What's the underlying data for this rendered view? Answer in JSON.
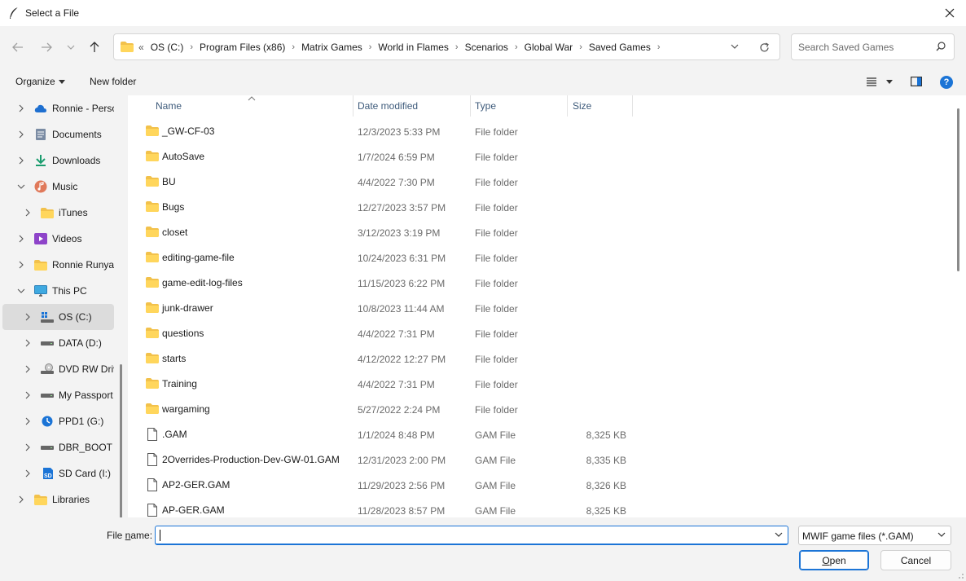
{
  "window": {
    "title": "Select a File",
    "close_label": "✕"
  },
  "nav": {
    "back_label": "←",
    "forward_label": "→",
    "recent_label": "⌄",
    "up_label": "↑",
    "overflow_label": "«",
    "breadcrumbs": [
      "OS (C:)",
      "Program Files (x86)",
      "Matrix Games",
      "World in Flames",
      "Scenarios",
      "Global War",
      "Saved Games"
    ],
    "crumb_sep": "›",
    "search_placeholder": "Search Saved Games"
  },
  "toolbar": {
    "organize_label": "Organize",
    "new_folder_label": "New folder",
    "help_label": "?"
  },
  "sidebar": {
    "items": [
      {
        "label": "Ronnie - Perso",
        "icon": "onedrive-icon",
        "expanded": false,
        "indent": 0
      },
      {
        "label": "Documents",
        "icon": "documents-icon",
        "expanded": false,
        "indent": 0
      },
      {
        "label": "Downloads",
        "icon": "downloads-icon",
        "expanded": false,
        "indent": 0
      },
      {
        "label": "Music",
        "icon": "music-icon",
        "expanded": true,
        "indent": 0
      },
      {
        "label": "iTunes",
        "icon": "folder-icon",
        "expanded": false,
        "indent": 1
      },
      {
        "label": "Videos",
        "icon": "videos-icon",
        "expanded": false,
        "indent": 0
      },
      {
        "label": "Ronnie Runyar",
        "icon": "folder-icon",
        "expanded": false,
        "indent": 0
      },
      {
        "label": "This PC",
        "icon": "monitor-icon",
        "expanded": true,
        "indent": 0
      },
      {
        "label": "OS (C:)",
        "icon": "windows-drive-icon",
        "expanded": false,
        "indent": 1,
        "selected": true
      },
      {
        "label": "DATA (D:)",
        "icon": "drive-icon",
        "expanded": false,
        "indent": 1
      },
      {
        "label": "DVD RW Driv",
        "icon": "dvd-drive-icon",
        "expanded": false,
        "indent": 1
      },
      {
        "label": "My Passport",
        "icon": "drive-icon",
        "expanded": false,
        "indent": 1
      },
      {
        "label": "PPD1 (G:)",
        "icon": "sync-drive-icon",
        "expanded": false,
        "indent": 1
      },
      {
        "label": "DBR_BOOT (H",
        "icon": "drive-icon",
        "expanded": false,
        "indent": 1
      },
      {
        "label": "SD Card (I:)",
        "icon": "sd-card-icon",
        "expanded": false,
        "indent": 1
      },
      {
        "label": "Libraries",
        "icon": "libraries-icon",
        "expanded": false,
        "indent": 0
      }
    ]
  },
  "columns": {
    "name": "Name",
    "date": "Date modified",
    "type": "Type",
    "size": "Size"
  },
  "files": [
    {
      "name": "_GW-CF-03",
      "date": "12/3/2023 5:33 PM",
      "type": "File folder",
      "size": "",
      "kind": "folder"
    },
    {
      "name": "AutoSave",
      "date": "1/7/2024 6:59 PM",
      "type": "File folder",
      "size": "",
      "kind": "folder"
    },
    {
      "name": "BU",
      "date": "4/4/2022 7:30 PM",
      "type": "File folder",
      "size": "",
      "kind": "folder"
    },
    {
      "name": "Bugs",
      "date": "12/27/2023 3:57 PM",
      "type": "File folder",
      "size": "",
      "kind": "folder"
    },
    {
      "name": "closet",
      "date": "3/12/2023 3:19 PM",
      "type": "File folder",
      "size": "",
      "kind": "folder"
    },
    {
      "name": "editing-game-file",
      "date": "10/24/2023 6:31 PM",
      "type": "File folder",
      "size": "",
      "kind": "folder"
    },
    {
      "name": "game-edit-log-files",
      "date": "11/15/2023 6:22 PM",
      "type": "File folder",
      "size": "",
      "kind": "folder"
    },
    {
      "name": "junk-drawer",
      "date": "10/8/2023 11:44 AM",
      "type": "File folder",
      "size": "",
      "kind": "folder"
    },
    {
      "name": "questions",
      "date": "4/4/2022 7:31 PM",
      "type": "File folder",
      "size": "",
      "kind": "folder"
    },
    {
      "name": "starts",
      "date": "4/12/2022 12:27 PM",
      "type": "File folder",
      "size": "",
      "kind": "folder"
    },
    {
      "name": "Training",
      "date": "4/4/2022 7:31 PM",
      "type": "File folder",
      "size": "",
      "kind": "folder"
    },
    {
      "name": "wargaming",
      "date": "5/27/2022 2:24 PM",
      "type": "File folder",
      "size": "",
      "kind": "folder"
    },
    {
      "name": ".GAM",
      "date": "1/1/2024 8:48 PM",
      "type": "GAM File",
      "size": "8,325 KB",
      "kind": "file"
    },
    {
      "name": "2Overrides-Production-Dev-GW-01.GAM",
      "date": "12/31/2023 2:00 PM",
      "type": "GAM File",
      "size": "8,335 KB",
      "kind": "file"
    },
    {
      "name": "AP2-GER.GAM",
      "date": "11/29/2023 2:56 PM",
      "type": "GAM File",
      "size": "8,326 KB",
      "kind": "file"
    },
    {
      "name": "AP-GER.GAM",
      "date": "11/28/2023 8:57 PM",
      "type": "GAM File",
      "size": "8,325 KB",
      "kind": "file"
    }
  ],
  "bottom": {
    "file_name_label_prefix": "File ",
    "file_name_label_accel": "n",
    "file_name_label_suffix": "ame:",
    "file_name_value": "",
    "filter_value": "MWIF game files (*.GAM)",
    "open_accel": "O",
    "open_rest": "pen",
    "cancel_label": "Cancel"
  }
}
